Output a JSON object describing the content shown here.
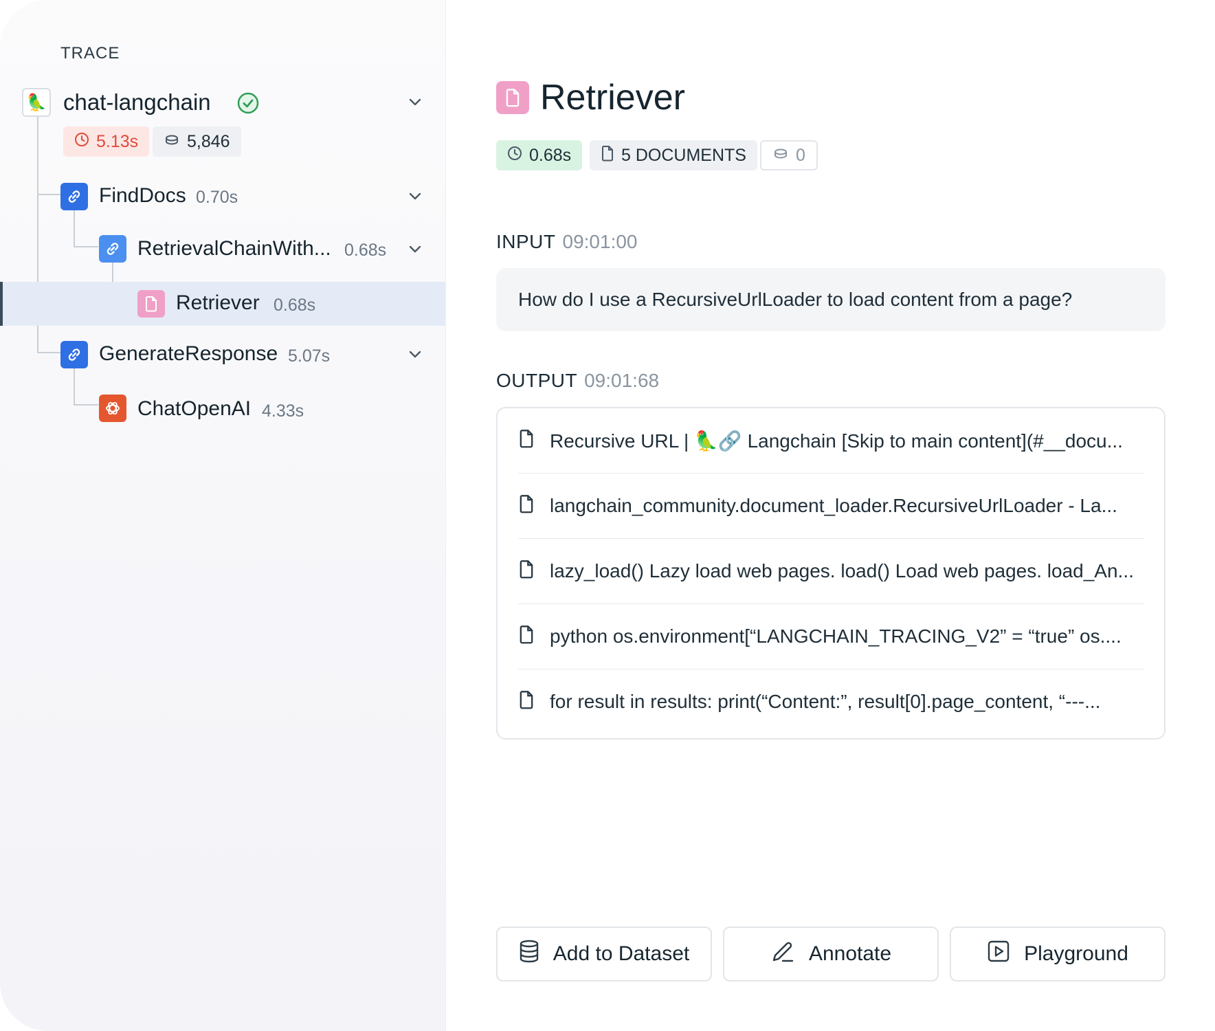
{
  "sidebar": {
    "heading": "TRACE",
    "root": {
      "title": "chat-langchain",
      "latency": "5.13s",
      "tokens": "5,846"
    },
    "nodes": [
      {
        "title": "FindDocs",
        "time": "0.70s"
      },
      {
        "title": "RetrievalChainWith...",
        "time": "0.68s"
      },
      {
        "title": "Retriever",
        "time": "0.68s"
      },
      {
        "title": "GenerateResponse",
        "time": "5.07s"
      },
      {
        "title": "ChatOpenAI",
        "time": "4.33s"
      }
    ]
  },
  "detail": {
    "title": "Retriever",
    "latency": "0.68s",
    "documents_badge": "5 DOCUMENTS",
    "tokens": "0",
    "input": {
      "label": "INPUT",
      "time": "09:01:00",
      "text": "How do I use a RecursiveUrlLoader to load content from a page?"
    },
    "output": {
      "label": "OUTPUT",
      "time": "09:01:68",
      "documents": [
        "Recursive URL | 🦜🔗 Langchain [Skip to main content](#__docu...",
        "langchain_community.document_loader.RecursiveUrlLoader - La...",
        "lazy_load() Lazy load web pages. load() Load web pages. load_An...",
        "python os.environment[“LANGCHAIN_TRACING_V2” = “true” os....",
        "for result in results: print(“Content:”, result[0].page_content, “---..."
      ]
    },
    "actions": {
      "add_to_dataset": "Add to Dataset",
      "annotate": "Annotate",
      "playground": "Playground"
    }
  },
  "colors": {
    "chain_blue": "#2f6fe4",
    "retriever_pink": "#f0a0c6",
    "openai_orange": "#e4572e",
    "success_green": "#2f9e55",
    "error_red": "#e04a3a"
  }
}
